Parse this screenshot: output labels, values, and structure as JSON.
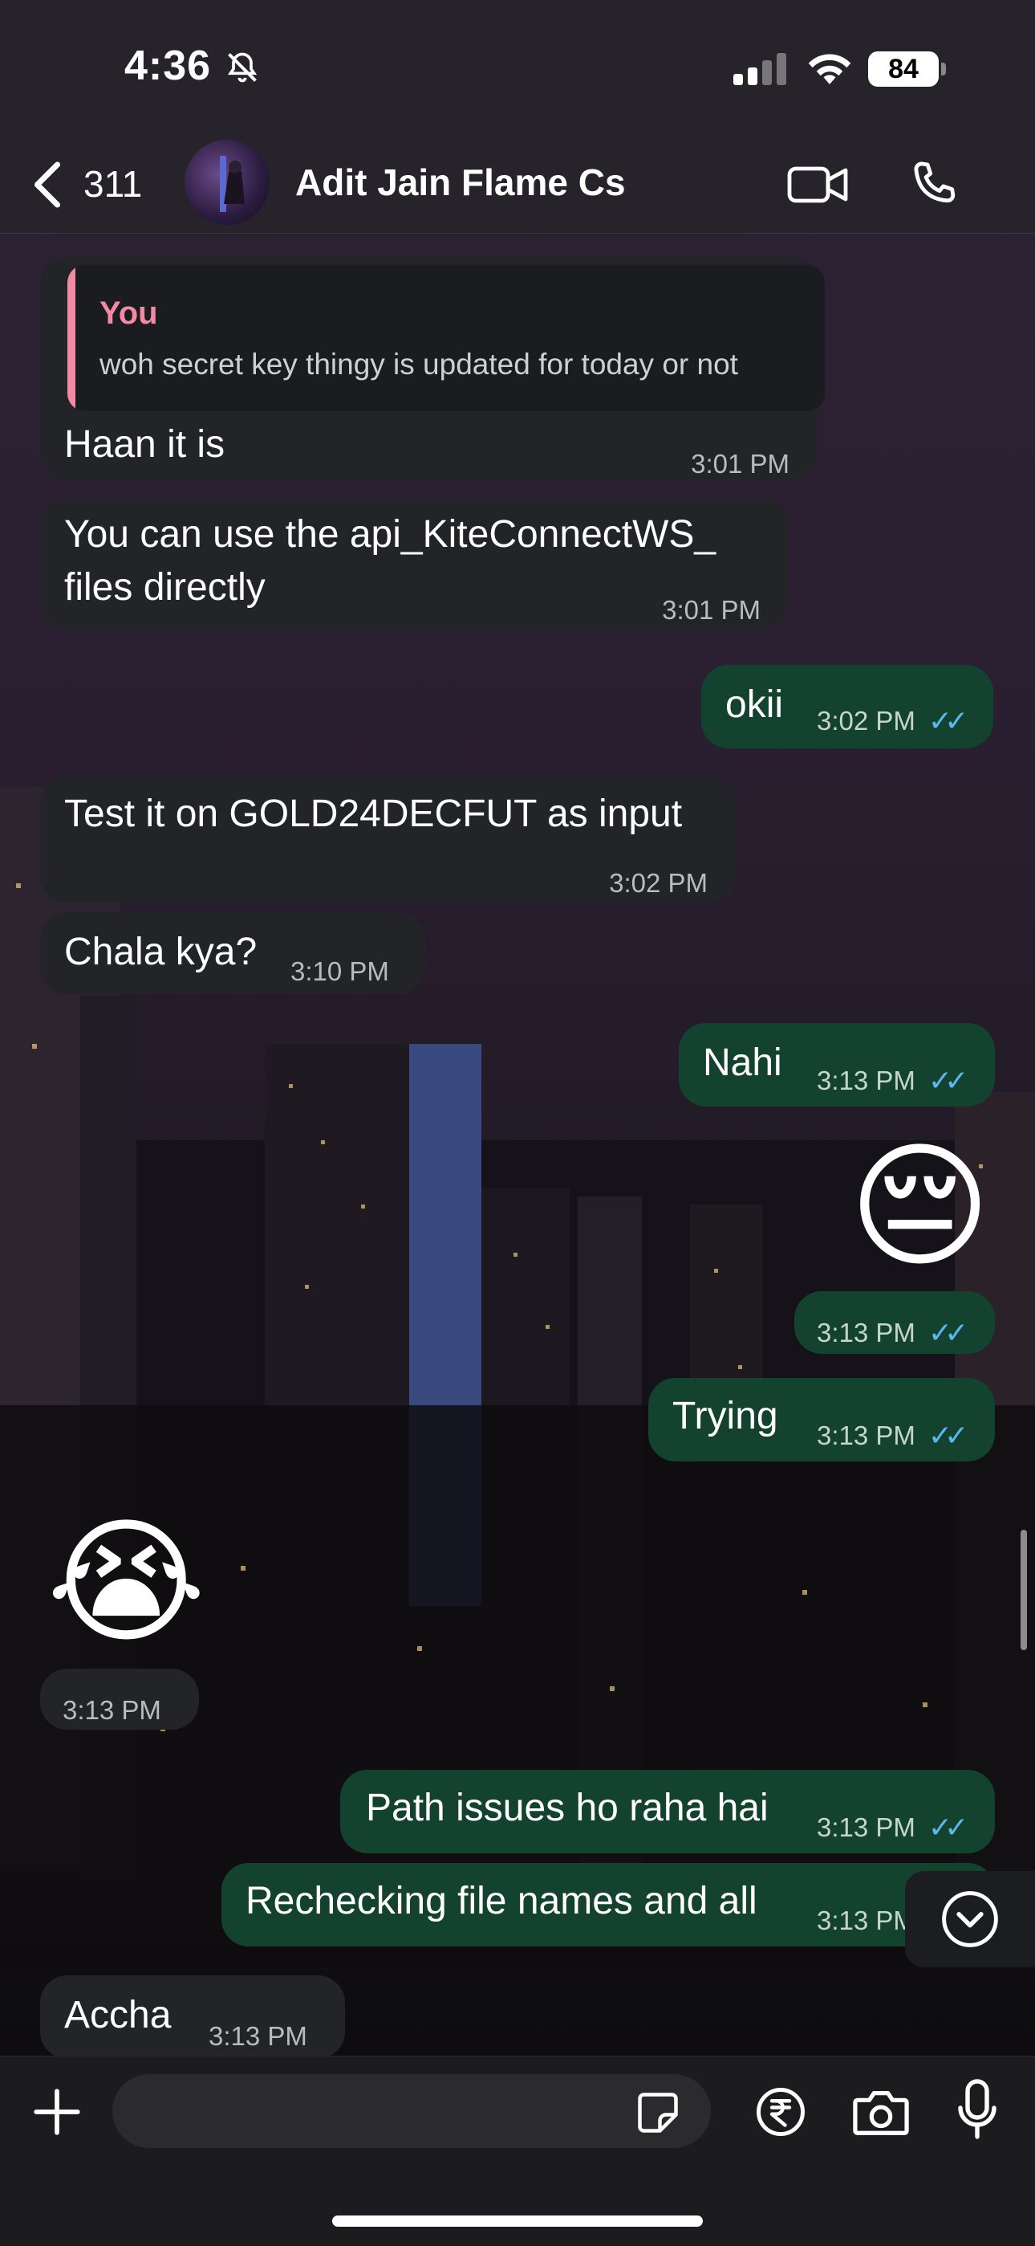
{
  "status_bar": {
    "time": "4:36",
    "battery": "84"
  },
  "header": {
    "back_count": "311",
    "contact_name": "Adit Jain Flame Cs"
  },
  "messages": [
    {
      "id": "m1",
      "dir": "in",
      "quote_author": "You",
      "quote_text": "woh secret key thingy is updated for today or not",
      "text": "Haan it is",
      "time": "3:01 PM"
    },
    {
      "id": "m2",
      "dir": "in",
      "text_line1": "You can use the api_KiteConnectWS_",
      "text_line2": "files directly",
      "time": "3:01 PM"
    },
    {
      "id": "m3",
      "dir": "out",
      "text": "okii",
      "time": "3:02 PM"
    },
    {
      "id": "m4",
      "dir": "in",
      "text": "Test it on GOLD24DECFUT as input",
      "time": "3:02 PM"
    },
    {
      "id": "m5",
      "dir": "in",
      "text": "Chala kya?",
      "time": "3:10 PM"
    },
    {
      "id": "m6",
      "dir": "out",
      "text": "Nahi",
      "time": "3:13 PM"
    },
    {
      "id": "m7",
      "dir": "out",
      "emoji": "😔",
      "time": "3:13 PM"
    },
    {
      "id": "m8",
      "dir": "out",
      "text": "Trying",
      "time": "3:13 PM"
    },
    {
      "id": "m9",
      "dir": "in",
      "emoji": "😭",
      "time": "3:13 PM"
    },
    {
      "id": "m10",
      "dir": "out",
      "text": "Path issues ho raha hai",
      "time": "3:13 PM"
    },
    {
      "id": "m11",
      "dir": "out",
      "text": "Rechecking file names and all",
      "time": "3:13 PM"
    },
    {
      "id": "m12",
      "dir": "in",
      "text": "Accha",
      "time": "3:13 PM"
    }
  ],
  "icons": {
    "back": "chevron-left-icon",
    "video": "video-camera-icon",
    "phone": "phone-icon",
    "plus": "plus-icon",
    "sticker": "sticker-icon",
    "payment": "rupee-icon",
    "camera": "camera-icon",
    "mic": "microphone-icon",
    "scroll_down": "chevron-down-circle-icon"
  },
  "colors": {
    "incoming": "#232428",
    "outgoing": "#13432f",
    "read_ticks": "#5ab8ef",
    "quote_accent": "#f28aa4"
  }
}
